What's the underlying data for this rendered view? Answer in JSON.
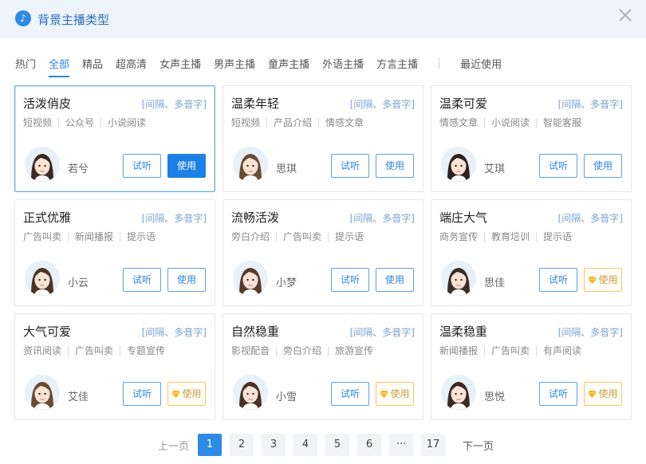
{
  "header": {
    "title": "背景主播类型"
  },
  "tabs": [
    "热门",
    "全部",
    "精品",
    "超高清",
    "女声主播",
    "男声主播",
    "童声主播",
    "外语主播",
    "方言主播"
  ],
  "tab_recent": "最近使用",
  "active_tab": "全部",
  "buttons": {
    "listen": "试听",
    "use": "使用"
  },
  "cards": [
    {
      "name": "活泼俏皮",
      "feature": "[间隔、多音字]",
      "tags": [
        "短视频",
        "公众号",
        "小说阅读"
      ],
      "speaker": "若兮",
      "use_style": "primary",
      "selected": true
    },
    {
      "name": "温柔年轻",
      "feature": "[间隔、多音字]",
      "tags": [
        "短视频",
        "产品介绍",
        "情感文章"
      ],
      "speaker": "思琪",
      "use_style": "normal"
    },
    {
      "name": "温柔可爱",
      "feature": "[间隔、多音字]",
      "tags": [
        "情感文章",
        "小说阅读",
        "智能客服"
      ],
      "speaker": "艾琪",
      "use_style": "normal"
    },
    {
      "name": "正式优雅",
      "feature": "[间隔、多音字]",
      "tags": [
        "广告叫卖",
        "新闻播报",
        "提示语"
      ],
      "speaker": "小云",
      "use_style": "normal"
    },
    {
      "name": "流畅活泼",
      "feature": "[间隔、多音字]",
      "tags": [
        "旁白介绍",
        "广告叫卖",
        "提示语"
      ],
      "speaker": "小梦",
      "use_style": "normal"
    },
    {
      "name": "端庄大气",
      "feature": "[间隔、多音字]",
      "tags": [
        "商务宣传",
        "教育培训",
        "提示语"
      ],
      "speaker": "思佳",
      "use_style": "vip"
    },
    {
      "name": "大气可爱",
      "feature": "[间隔、多音字]",
      "tags": [
        "资讯阅读",
        "广告叫卖",
        "专题宣传"
      ],
      "speaker": "艾佳",
      "use_style": "vip"
    },
    {
      "name": "自然稳重",
      "feature": "[间隔、多音字]",
      "tags": [
        "影视配音",
        "旁白介绍",
        "旅游宣传"
      ],
      "speaker": "小雪",
      "use_style": "vip"
    },
    {
      "name": "温柔稳重",
      "feature": "[间隔、多音字]",
      "tags": [
        "新闻播报",
        "广告叫卖",
        "有声阅读"
      ],
      "speaker": "思悦",
      "use_style": "vip"
    }
  ],
  "pagination": {
    "prev": "上一页",
    "next": "下一页",
    "pages": [
      "1",
      "2",
      "3",
      "4",
      "5",
      "6",
      "···",
      "17"
    ],
    "current": "1"
  },
  "colors": {
    "accent": "#2e86de",
    "header_bg": "#eef4fb",
    "vip": "#f0c96a"
  }
}
